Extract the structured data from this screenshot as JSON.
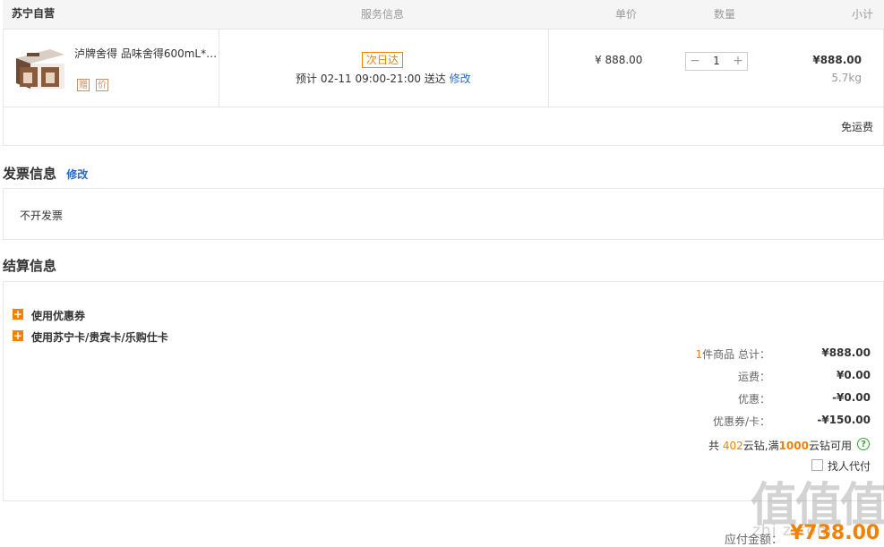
{
  "order": {
    "store": "苏宁自营",
    "headers": {
      "service": "服务信息",
      "unit_price": "单价",
      "quantity": "数量",
      "subtotal": "小计"
    },
    "item": {
      "name": "泸牌舍得 品味舍得600mL*2...",
      "tags": [
        "赠",
        "价"
      ],
      "delivery_badge": "次日达",
      "eta": "预计 02-11 09:00-21:00 送达",
      "eta_edit": "修改",
      "unit_price": "¥ 888.00",
      "qty_minus": "−",
      "qty_value": "1",
      "qty_plus": "+",
      "subtotal": "¥888.00",
      "weight": "5.7kg"
    },
    "shipping_note": "免运费"
  },
  "invoice": {
    "title": "发票信息",
    "edit": "修改",
    "value": "不开发票"
  },
  "settlement": {
    "title": "结算信息",
    "options": [
      "使用优惠券",
      "使用苏宁卡/贵宾卡/乐购仕卡"
    ],
    "count": "1",
    "total_label": "件商品 总计：",
    "total_value": "¥888.00",
    "freight_label": "运费：",
    "freight_value": "¥0.00",
    "discount_label": "优惠：",
    "discount_value": "-¥0.00",
    "coupon_label": "优惠券/卡：",
    "coupon_value": "-¥150.00",
    "yunzuan_pre": "共",
    "yunzuan_count": "402",
    "yunzuan_mid": "云钻,满",
    "yunzuan_threshold": "1000",
    "yunzuan_post": "云钻可用",
    "help_icon": "?",
    "proxy_pay": "找人代付",
    "pay_label": "应付金额：",
    "pay_value": "¥738.00"
  },
  "watermark": {
    "logo": "值值值",
    "url": "zhi z.com"
  },
  "colors": {
    "accent": "#f08200",
    "link": "#2a6bc6",
    "border": "#e6e6e6"
  }
}
